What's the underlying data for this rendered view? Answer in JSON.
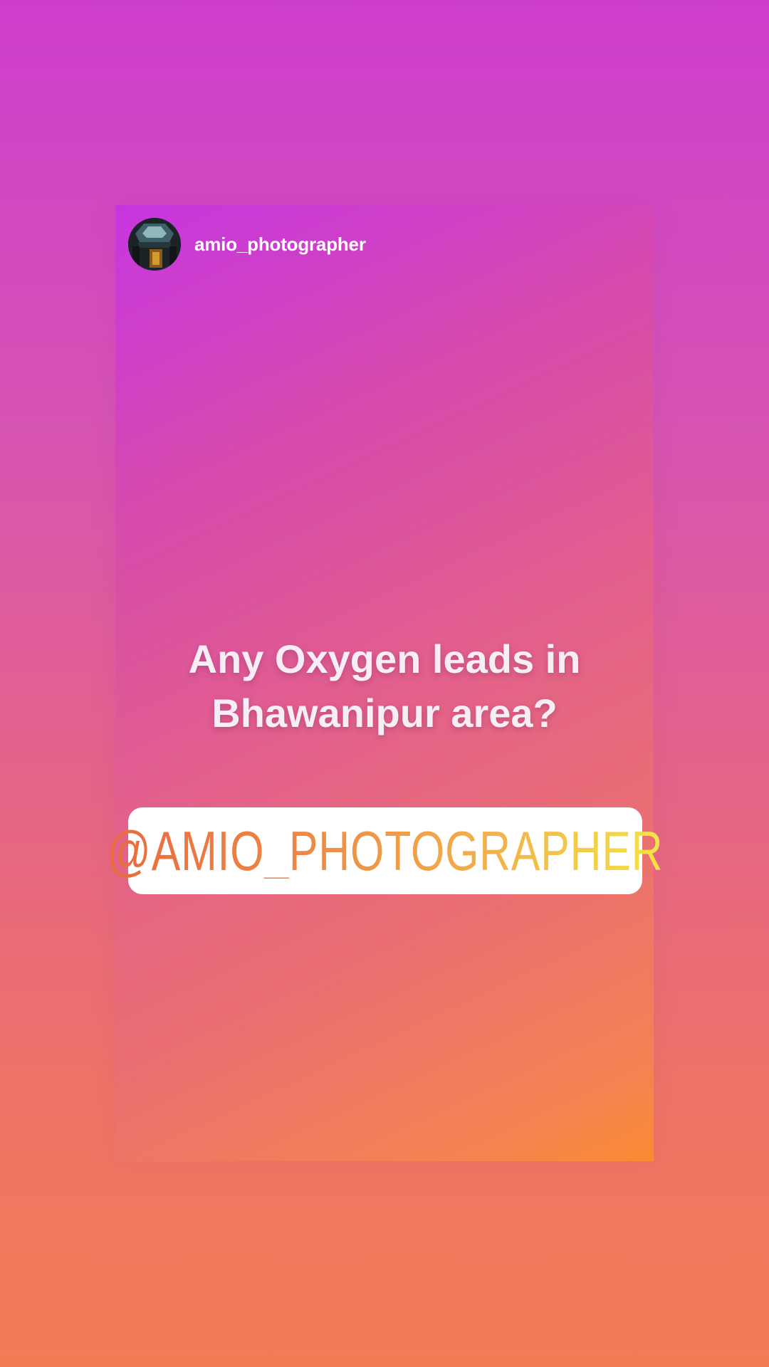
{
  "story": {
    "username": "amio_photographer",
    "question": "Any Oxygen leads in Bhawanipur area?",
    "mention": "@AMIO_PHOTOGRAPHER",
    "avatar_icon": "profile-photo-icon"
  },
  "colors": {
    "background_top": "#cc3dcc",
    "background_bottom": "#f37b54",
    "card_start": "#c636e0",
    "card_end": "#fa8b31",
    "mention_gradient_start": "#ea6a3c",
    "mention_gradient_end": "#f4e447"
  }
}
